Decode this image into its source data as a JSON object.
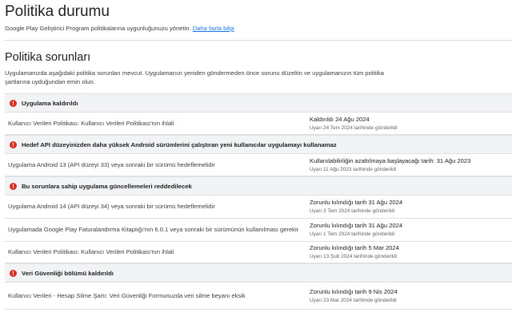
{
  "header": {
    "title": "Politika durumu",
    "subtitle": "Google Play Geliştirici Program politikalarına uygunluğunuzu yönetin.",
    "learn_more": "Daha fazla bilgi"
  },
  "section": {
    "title": "Politika sorunları",
    "description": "Uygulamanızda aşağıdaki politika sorunları mevcut. Uygulamanızı yeniden göndermeden önce sorunu düzeltin ve uygulamanızın tüm politika şartlarına uyduğundan emin olun."
  },
  "colors": {
    "error": "#d93025",
    "link": "#1a73e8",
    "header_bg": "#f1f3f4"
  },
  "groups": [
    {
      "icon": "error-icon",
      "title": "Uygulama kaldırıldı",
      "rows": [
        {
          "issue": "Kullanıcı Verileri Politikası: Kullanıcı Verileri Politikası'nın ihlali",
          "deadline": "Kaldırıldı 24 Ağu 2024",
          "sent": "Uyarı 24 Tem 2024 tarihinde gönderildi"
        }
      ]
    },
    {
      "icon": "error-icon",
      "title": "Hedef API düzeyinizden daha yüksek Android sürümlerini çalıştıran yeni kullanıcılar uygulamayı kullanamaz",
      "rows": [
        {
          "issue": "Uygulama Android 13 (API düzeyi 33) veya sonraki bir sürümü hedeflemelidir",
          "deadline": "Kullanılabilirliğin azaltılmaya başlayacağı tarih: 31 Ağu 2023",
          "sent": "Uyarı 11 Ağu 2023 tarihinde gönderildi"
        }
      ]
    },
    {
      "icon": "error-icon",
      "title": "Bu sorunlara sahip uygulama güncellemeleri reddedilecek",
      "rows": [
        {
          "issue": "Uygulama Android 14 (API düzeyi 34) veya sonraki bir sürümü hedeflemelidir",
          "deadline": "Zorunlu kılındığı tarih 31 Ağu 2024",
          "sent": "Uyarı 3 Tem 2024 tarihinde gönderildi"
        },
        {
          "issue": "Uygulamada Google Play Faturalandırma Kitaplığı'nın 6.0.1 veya sonraki bir sürümünün kullanılması gerekir",
          "deadline": "Zorunlu kılındığı tarih 31 Ağu 2024",
          "sent": "Uyarı 1 Tem 2024 tarihinde gönderildi"
        },
        {
          "issue": "Kullanıcı Verileri Politikası: Kullanıcı Verileri Politikası'nın ihlali",
          "deadline": "Zorunlu kılındığı tarih 5 Mar 2024",
          "sent": "Uyarı 13 Şub 2024 tarihinde gönderildi"
        }
      ]
    },
    {
      "icon": "error-icon",
      "title": "Veri Güvenliği bölümü kaldırıldı",
      "rows": [
        {
          "issue": "Kullanıcı Verileri - Hesap Silme Şartı: Veri Güvenliği Formunuzda veri silme beyanı eksik",
          "deadline": "Zorunlu kılındığı tarih 9 Nis 2024",
          "sent": "Uyarı 23 Mar 2024 tarihinde gönderildi"
        }
      ]
    }
  ]
}
